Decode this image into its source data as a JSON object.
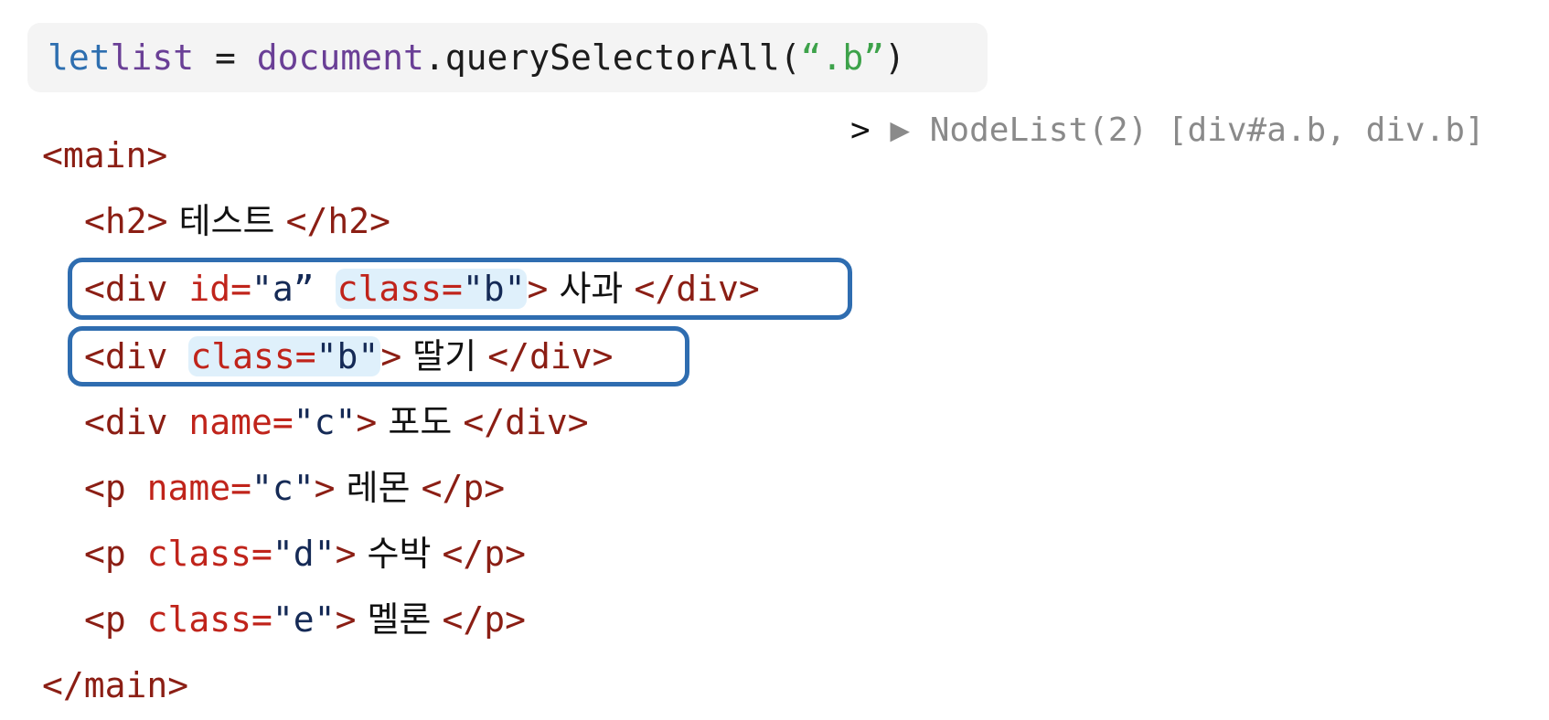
{
  "query": {
    "kw": "let",
    "var": "list",
    "eq": " = ",
    "obj": "document",
    "method": ".querySelectorAll(",
    "arg": "“.b”",
    "close": ")"
  },
  "console": {
    "prompt": ">",
    "arrow": "▶",
    "result": "NodeList(2) [div#a.b, div.b]"
  },
  "html": {
    "main_open": "<main>",
    "main_close": "</main>",
    "h2_open": "<h2>",
    "h2_text": " 테스트 ",
    "h2_close": "</h2>",
    "div1_open": "<div ",
    "div1_attr_id": "id=",
    "div1_id_val": "\"a”",
    "div1_attr_class": "class=",
    "div1_class_val": "\"b\"",
    "div1_gt": ">",
    "div1_text": " 사과 ",
    "div1_close": "</div>",
    "div2_open": "<div ",
    "div2_attr_class": "class=",
    "div2_class_val": "\"b\"",
    "div2_gt": ">",
    "div2_text": " 딸기 ",
    "div2_close": "</div>",
    "div3_open": "<div ",
    "div3_attr": "name=",
    "div3_val": "\"c\"",
    "div3_gt": ">",
    "div3_text": " 포도 ",
    "div3_close": "</div>",
    "p1_open": "<p ",
    "p1_attr": "name=",
    "p1_val": "\"c\"",
    "p1_gt": ">",
    "p1_text": " 레몬 ",
    "p1_close": "</p>",
    "p2_open": "<p ",
    "p2_attr": "class=",
    "p2_val": "\"d\"",
    "p2_gt": ">",
    "p2_text": " 수박 ",
    "p2_close": "</p>",
    "p3_open": "<p ",
    "p3_attr": "class=",
    "p3_val": "\"e\"",
    "p3_gt": ">",
    "p3_text": " 멜론 ",
    "p3_close": "</p>"
  }
}
